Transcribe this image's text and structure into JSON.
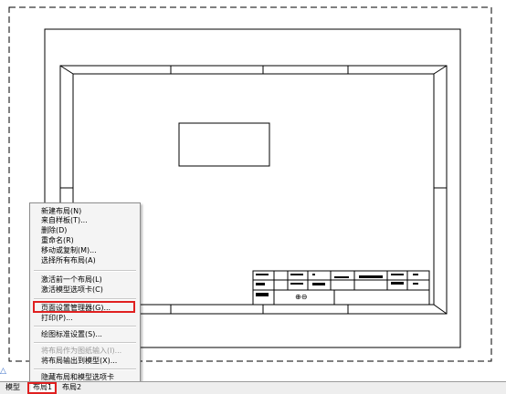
{
  "context_menu": {
    "items": [
      {
        "label": "新建布局(N)",
        "enabled": true
      },
      {
        "label": "来自样板(T)...",
        "enabled": true
      },
      {
        "label": "删除(D)",
        "enabled": true
      },
      {
        "label": "重命名(R)",
        "enabled": true
      },
      {
        "label": "移动或复制(M)...",
        "enabled": true
      },
      {
        "label": "选择所有布局(A)",
        "enabled": true
      },
      {
        "label": "激活前一个布局(L)",
        "enabled": true
      },
      {
        "label": "激活模型选项卡(C)",
        "enabled": true
      },
      {
        "label": "页面设置管理器(G)...",
        "enabled": true,
        "highlighted": true
      },
      {
        "label": "打印(P)...",
        "enabled": true
      },
      {
        "label": "绘图标准设置(S)...",
        "enabled": true
      },
      {
        "label": "将布局作为图纸输入(I)...",
        "enabled": false
      },
      {
        "label": "将布局输出到模型(X)...",
        "enabled": true
      },
      {
        "label": "隐藏布局和模型选项卡",
        "enabled": true
      }
    ]
  },
  "tabs": [
    {
      "label": "模型",
      "active": false
    },
    {
      "label": "布局1",
      "active": true
    },
    {
      "label": "布局2",
      "active": false
    }
  ],
  "title_block": {
    "symbol": "⊕⊖"
  },
  "colors": {
    "highlight": "#e02020",
    "drawing_lines": "#000000"
  }
}
